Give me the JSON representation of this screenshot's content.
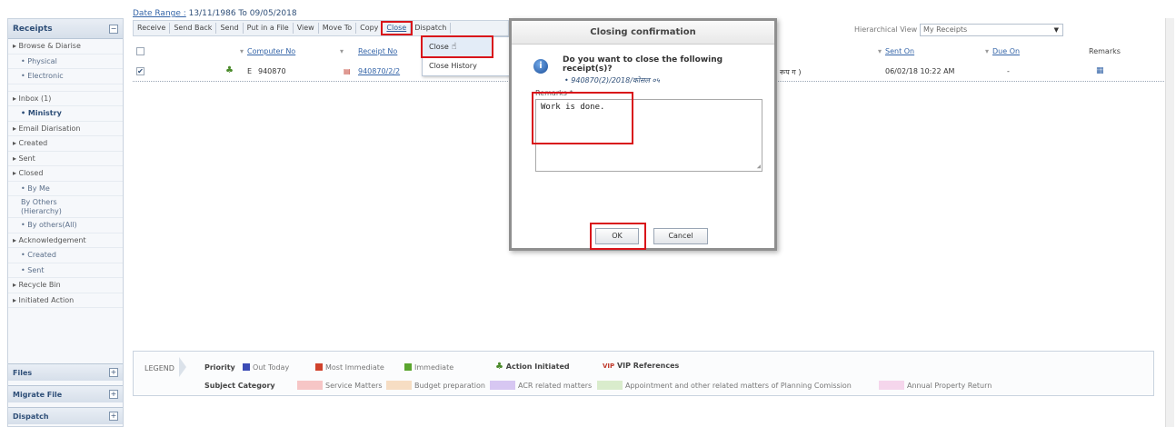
{
  "sidebar": {
    "header": "Receipts",
    "items": [
      {
        "label": "▸ Browse & Diarise",
        "type": "item"
      },
      {
        "label": "• Physical",
        "type": "sub"
      },
      {
        "label": "• Electronic",
        "type": "sub"
      },
      {
        "label": "▸ Inbox (1)",
        "type": "item"
      },
      {
        "label": "• Ministry",
        "type": "sub-active"
      },
      {
        "label": "▸ Email Diarisation",
        "type": "item"
      },
      {
        "label": "▸ Created",
        "type": "item"
      },
      {
        "label": "▸ Sent",
        "type": "item"
      },
      {
        "label": "▸ Closed",
        "type": "item"
      },
      {
        "label": "• By Me",
        "type": "sub"
      },
      {
        "label": "By Others",
        "label2": "(Hierarchy)",
        "type": "sub-two"
      },
      {
        "label": "• By others(All)",
        "type": "sub"
      },
      {
        "label": "▸ Acknowledgement",
        "type": "item"
      },
      {
        "label": "• Created",
        "type": "sub"
      },
      {
        "label": "• Sent",
        "type": "sub"
      },
      {
        "label": "▸ Recycle Bin",
        "type": "item"
      },
      {
        "label": "▸ Initiated Action",
        "type": "item"
      }
    ],
    "panels": [
      "Files",
      "Migrate File",
      "Dispatch"
    ]
  },
  "date_range": {
    "label": "Date Range :",
    "value": "13/11/1986 To 09/05/2018"
  },
  "toolbar": [
    "Receive",
    "Send Back",
    "Send",
    "Put in a File",
    "View",
    "Move To",
    "Copy",
    "Close",
    "Dispatch"
  ],
  "hierarchical": {
    "label": "Hierarchical View",
    "selected": "My Receipts"
  },
  "grid": {
    "headers": {
      "computer_no": "Computer No",
      "receipt_no": "Receipt No",
      "sent_on": "Sent On",
      "due_on": "Due On",
      "remarks": "Remarks"
    },
    "row": {
      "type": "E",
      "computer_no": "940870",
      "receipt_no": "940870/2/2",
      "subject_tail": "रूप ग )",
      "sent_on": "06/02/18 10:22 AM",
      "due_on": "-"
    }
  },
  "dropdown": [
    "Close",
    "Close History"
  ],
  "dialog": {
    "title": "Closing confirmation",
    "question": "Do you want to close the following receipt(s)?",
    "receipt": "940870(2)/2018/कोसल ०५",
    "remarks_label": "Remarks *",
    "remarks_value": "Work is done.",
    "ok": "OK",
    "cancel": "Cancel"
  },
  "legend": {
    "label": "LEGEND",
    "priority": "Priority",
    "priority_items": [
      {
        "label": "Out Today",
        "color": "#3b4bb5"
      },
      {
        "label": "Most Immediate",
        "color": "#d0422b"
      },
      {
        "label": "Immediate",
        "color": "#5aa52e"
      }
    ],
    "action_initiated": "Action Initiated",
    "vip": "VIP References",
    "vip_mark": "VIP",
    "subject_category": "Subject Category",
    "categories": [
      {
        "label": "Service Matters",
        "color": "#f6c6c6"
      },
      {
        "label": "Budget preparation",
        "color": "#f6ddc3"
      },
      {
        "label": "ACR related matters",
        "color": "#d7c7f2"
      },
      {
        "label": "Appointment and other related matters of Planning Comission",
        "color": "#d9eccc"
      },
      {
        "label": "Annual Property Return",
        "color": "#f5d6ec"
      }
    ]
  }
}
